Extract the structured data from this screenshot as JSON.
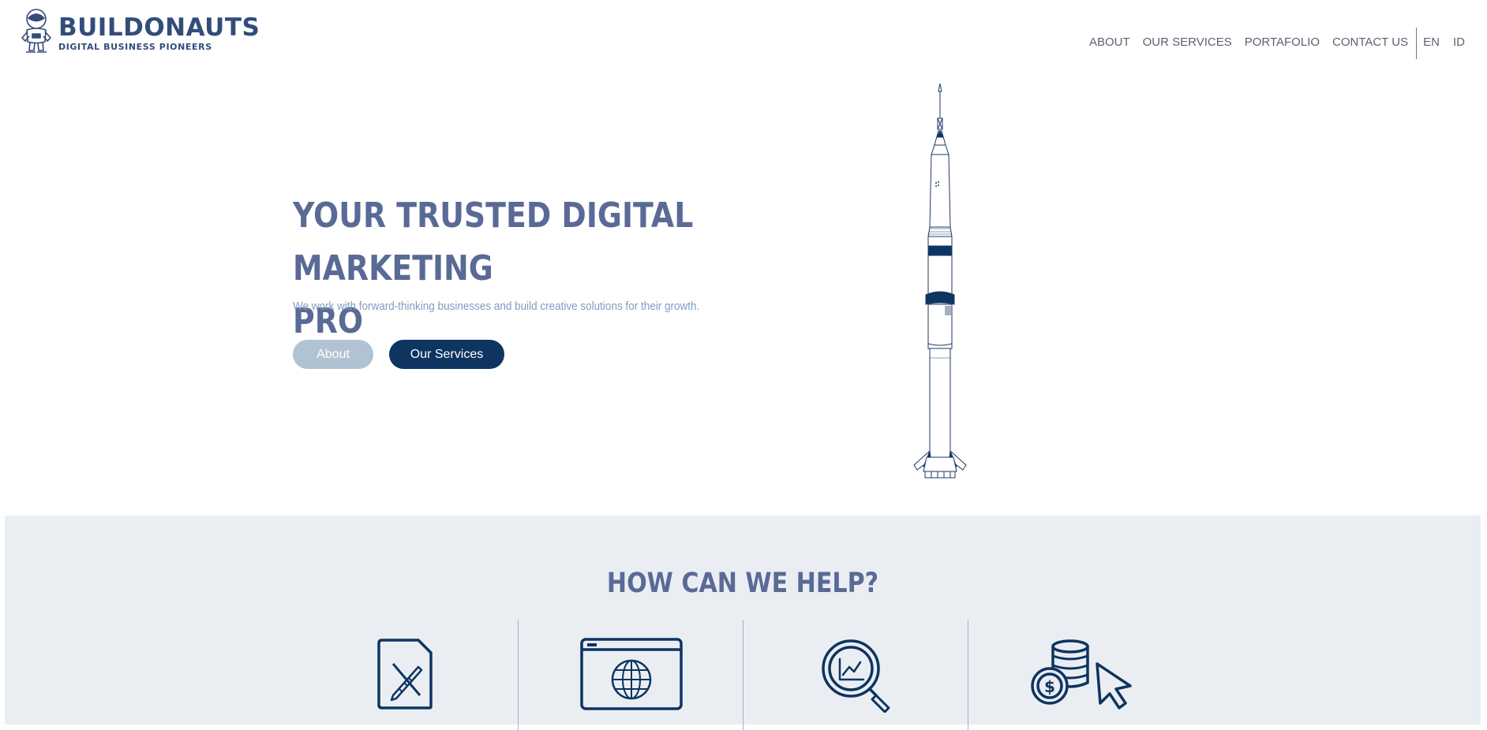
{
  "brand": {
    "name": "BUILDONAUTS",
    "tagline": "DIGITAL BUSINESS PIONEERS",
    "color": "#324d7a"
  },
  "nav": {
    "items": [
      "ABOUT",
      "OUR SERVICES",
      "PORTAFOLIO",
      "CONTACT US"
    ],
    "languages": [
      "EN",
      "ID"
    ]
  },
  "hero": {
    "title_line1": "YOUR TRUSTED DIGITAL MARKETING",
    "title_line2": "PRO",
    "subtitle": "We work with forward-thinking businesses and build creative solutions for their growth.",
    "about_button": "About",
    "services_button": "Our Services",
    "title_color": "#5a6a96",
    "primary_color": "#0e3460"
  },
  "help": {
    "title": "HOW CAN WE HELP?",
    "background": "#eaeef3",
    "icons": [
      "design-document-icon",
      "web-browser-globe-icon",
      "analytics-search-icon",
      "cost-per-click-icon"
    ]
  }
}
